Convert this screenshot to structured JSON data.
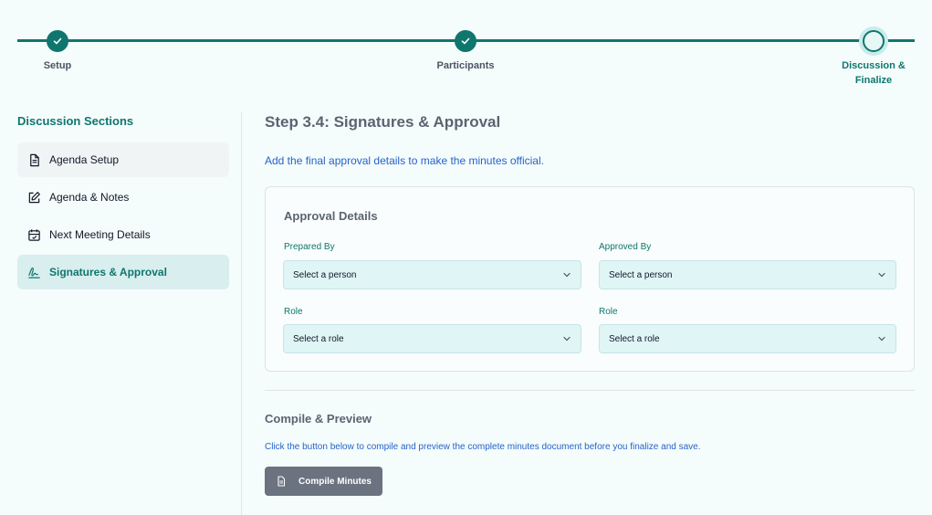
{
  "stepper": {
    "steps": [
      {
        "label": "Setup",
        "status": "completed"
      },
      {
        "label": "Participants",
        "status": "completed"
      },
      {
        "label_line1": "Discussion &",
        "label_line2": "Finalize",
        "status": "current"
      }
    ]
  },
  "sidebar": {
    "title": "Discussion Sections",
    "items": [
      {
        "label": "Agenda Setup",
        "icon": "document-icon"
      },
      {
        "label": "Agenda & Notes",
        "icon": "edit-icon"
      },
      {
        "label": "Next Meeting Details",
        "icon": "calendar-icon"
      },
      {
        "label": "Signatures & Approval",
        "icon": "signature-icon",
        "active": true
      }
    ]
  },
  "main": {
    "title": "Step 3.4: Signatures & Approval",
    "description": "Add the final approval details to make the minutes official.",
    "approval": {
      "title": "Approval Details",
      "prepared_by_label": "Prepared By",
      "prepared_by_value": "Select a person",
      "approved_by_label": "Approved By",
      "approved_by_value": "Select a person",
      "role_left_label": "Role",
      "role_left_value": "Select a role",
      "role_right_label": "Role",
      "role_right_value": "Select a role"
    },
    "compile": {
      "title": "Compile & Preview",
      "description": "Click the button below to compile and preview the complete minutes document before you finalize and save.",
      "button_label": "Compile Minutes"
    }
  },
  "colors": {
    "accent": "#0f766e",
    "link_text": "#2563c9",
    "select_bg": "#e0f5f6",
    "button_bg": "#6b7280"
  }
}
